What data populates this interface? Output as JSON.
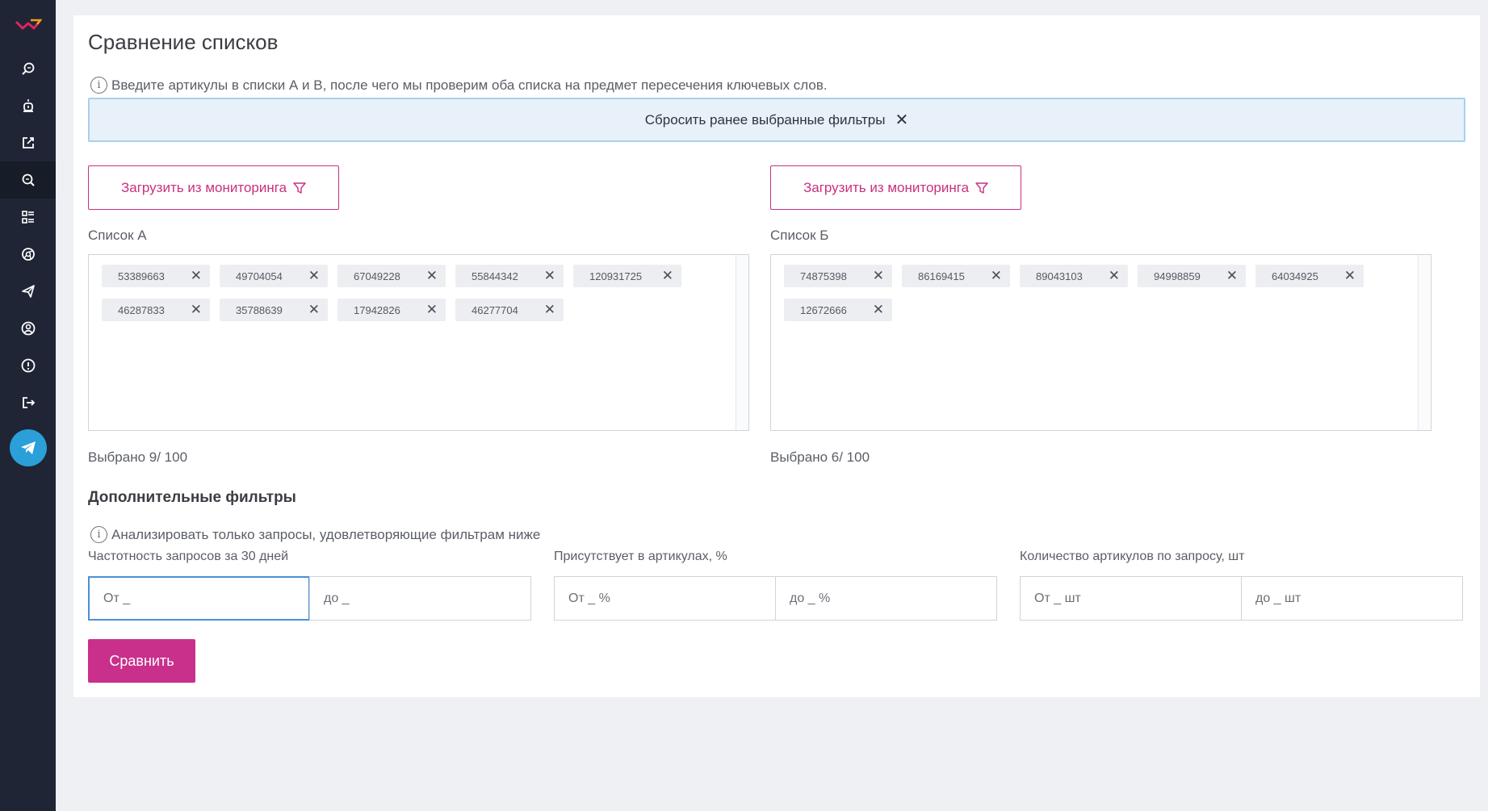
{
  "page": {
    "title": "Сравнение списков",
    "hint": "Введите артикулы в списки А и В, после чего мы проверим оба списка на предмет пересечения ключевых слов.",
    "reset_label": "Сбросить ранее выбранные фильтры"
  },
  "list_a": {
    "load_label": "Загрузить из мониторинга",
    "label": "Список А",
    "items": [
      "53389663",
      "49704054",
      "67049228",
      "55844342",
      "120931725",
      "46287833",
      "35788639",
      "17942826",
      "46277704"
    ],
    "counter": "Выбрано 9/ 100"
  },
  "list_b": {
    "load_label": "Загрузить из мониторинга",
    "label": "Список Б",
    "items": [
      "74875398",
      "86169415",
      "89043103",
      "94998859",
      "64034925",
      "12672666"
    ],
    "counter": "Выбрано 6/ 100"
  },
  "filters": {
    "title": "Дополнительные фильтры",
    "hint": "Анализировать только запросы, удовлетворяющие фильтрам ниже",
    "frequency": {
      "label": "Частотность запросов за 30 дней",
      "from_placeholder": "От _",
      "to_placeholder": "до _"
    },
    "presence": {
      "label": "Присутствует в артикулах, %",
      "from_placeholder": "От _ %",
      "to_placeholder": "до _ %"
    },
    "count": {
      "label": "Количество артикулов по запросу, шт",
      "from_placeholder": "От _ шт",
      "to_placeholder": "до _ шт"
    }
  },
  "compare_label": "Сравнить",
  "colors": {
    "accent": "#c9308c",
    "sidebar": "#1f2535",
    "telegram": "#2a9fd8",
    "reset_bg": "#e8f1f9"
  },
  "sidebar_icons": [
    "logo-icon",
    "keyword-search-icon",
    "alarm-icon",
    "edit-external-icon",
    "compare-search-icon",
    "list-grid-icon",
    "chrome-icon",
    "send-icon",
    "user-circle-icon",
    "alert-circle-icon",
    "logout-icon",
    "telegram-icon"
  ]
}
